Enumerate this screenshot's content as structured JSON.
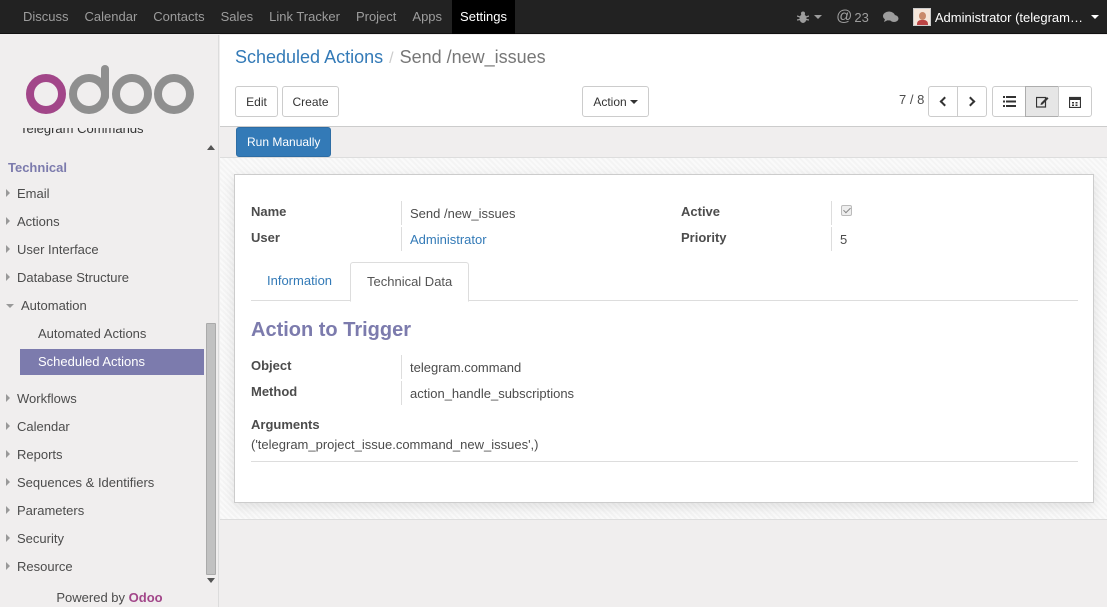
{
  "topbar": {
    "menu": [
      "Discuss",
      "Calendar",
      "Contacts",
      "Sales",
      "Link Tracker",
      "Project",
      "Apps",
      "Settings"
    ],
    "active_menu": "Settings",
    "messages_count": "23",
    "user": "Administrator (telegram…"
  },
  "sidebar": {
    "partial_item": "Telegram Commands",
    "section": "Technical",
    "items_top": [
      "Email",
      "Actions",
      "User Interface",
      "Database Structure"
    ],
    "automation": "Automation",
    "automation_children": [
      "Automated Actions",
      "Scheduled Actions"
    ],
    "items_bottom": [
      "Workflows",
      "Calendar",
      "Reports",
      "Sequences & Identifiers",
      "Parameters",
      "Security",
      "Resource"
    ],
    "powered_by": "Powered by",
    "brand": "Odoo"
  },
  "control_panel": {
    "breadcrumb_parent": "Scheduled Actions",
    "breadcrumb_current": "Send /new_issues",
    "edit_label": "Edit",
    "create_label": "Create",
    "action_label": "Action",
    "pager": "7 / 8",
    "run_manually_label": "Run Manually"
  },
  "form": {
    "name_label": "Name",
    "name_value": "Send /new_issues",
    "user_label": "User",
    "user_value": "Administrator",
    "active_label": "Active",
    "active_checked": true,
    "priority_label": "Priority",
    "priority_value": "5",
    "tabs": [
      "Information",
      "Technical Data"
    ],
    "active_tab": "Technical Data",
    "section_title": "Action to Trigger",
    "object_label": "Object",
    "object_value": "telegram.command",
    "method_label": "Method",
    "method_value": "action_handle_subscriptions",
    "arguments_label": "Arguments",
    "arguments_value": "('telegram_project_issue.command_new_issues',)"
  },
  "colors": {
    "brand_purple": "#7c7bad",
    "link_blue": "#337ab7",
    "navbar": "#222222",
    "odoo_logo": "#a24689"
  }
}
